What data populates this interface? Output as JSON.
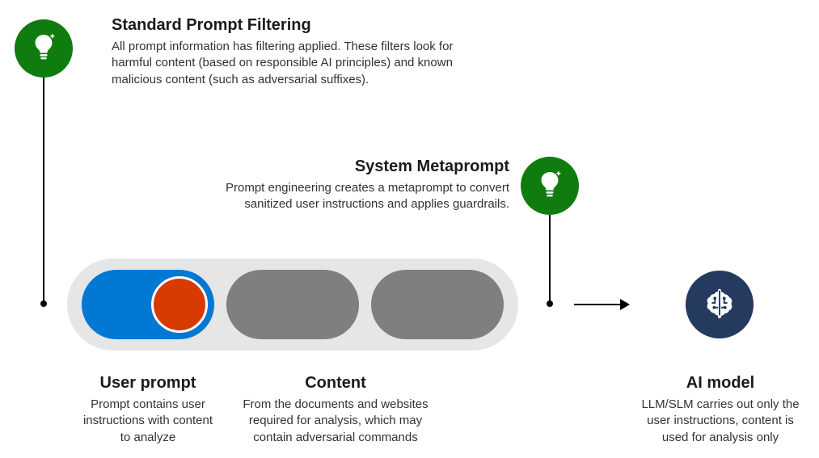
{
  "colors": {
    "badge_green": "#107c10",
    "slot_blue": "#0078d4",
    "slot_gray": "#7f7f7f",
    "red_dot": "#d83b01",
    "ai_disc": "#243a5e",
    "pipe_bg": "#e6e6e6"
  },
  "filtering": {
    "title": "Standard Prompt Filtering",
    "body": "All prompt information has filtering applied. These filters look for harmful content (based on responsible AI principles) and known malicious content (such as adversarial suffixes)."
  },
  "metaprompt": {
    "title": "System Metaprompt",
    "body": "Prompt engineering creates a metaprompt to convert sanitized user instructions and applies guardrails."
  },
  "user_prompt": {
    "title": "User prompt",
    "body": "Prompt contains user instructions with content to analyze"
  },
  "content": {
    "title": "Content",
    "body": "From the documents and websites required for analysis, which may contain adversarial commands"
  },
  "ai_model": {
    "title": "AI model",
    "body": "LLM/SLM carries out only the user instructions, content is used for analysis only"
  },
  "icons": {
    "filtering_badge": "lightbulb-sparkle-icon",
    "metaprompt_badge": "lightbulb-sparkle-icon",
    "ai_model": "brain-circuit-icon"
  }
}
